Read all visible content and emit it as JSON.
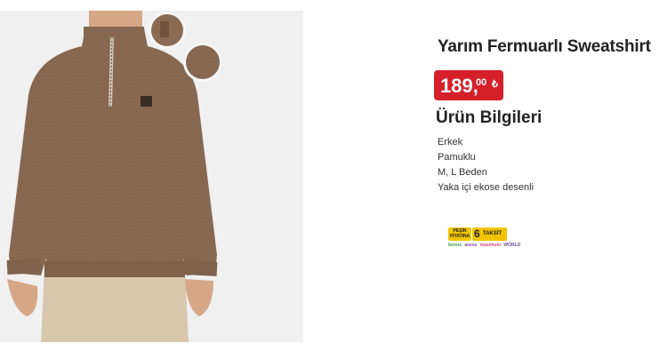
{
  "product": {
    "title": "Yarım Fermuarlı Sweatshirt",
    "price_main": "189,",
    "price_decimal": "00",
    "currency_symbol": "₺"
  },
  "info": {
    "section_title": "Ürün Bilgileri",
    "features": [
      "Erkek",
      "Pamuklu",
      "M, L Beden",
      "Yaka içi ekose desenli"
    ]
  },
  "installment_badge": {
    "cash_label": "PEŞİN FİYATINA",
    "installment_count": "6",
    "installment_label": "TAKSİT",
    "partners": [
      "bonus",
      "axess",
      "maximum",
      "WORLD"
    ]
  },
  "colors": {
    "price_bg": "#d5202a",
    "sweatshirt": "#8a6a52",
    "badge_bg": "#f2c400"
  }
}
